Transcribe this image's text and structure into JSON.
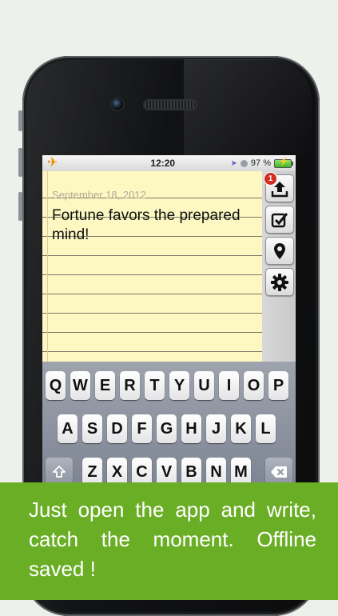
{
  "status_bar": {
    "time": "12:20",
    "battery": "97 %",
    "icons": [
      "airplane-icon",
      "location-arrow-icon",
      "lock-rotation-icon",
      "battery-icon"
    ],
    "colors": {
      "airplane": "#f08a00",
      "location": "#7a55c9",
      "battery_fill": "#3eb51f"
    }
  },
  "note": {
    "date": "September 18, 2012",
    "text": "Fortune favors the prepared mind!"
  },
  "toolbar": {
    "items": [
      {
        "name": "upload-button",
        "icon": "upload-tray-icon",
        "badge": "1"
      },
      {
        "name": "checklist-button",
        "icon": "checkbox-icon"
      },
      {
        "name": "location-button",
        "icon": "map-pin-icon"
      },
      {
        "name": "settings-button",
        "icon": "gear-icon"
      }
    ]
  },
  "keyboard": {
    "row1": [
      "Q",
      "W",
      "E",
      "R",
      "T",
      "Y",
      "U",
      "I",
      "O",
      "P"
    ],
    "row2": [
      "A",
      "S",
      "D",
      "F",
      "G",
      "H",
      "J",
      "K",
      "L"
    ],
    "row3": [
      "Z",
      "X",
      "C",
      "V",
      "B",
      "N",
      "M"
    ],
    "special": {
      "shift": "shift-icon",
      "delete": "delete-key-icon"
    }
  },
  "caption": {
    "text": "Just open the app and write, catch the moment. Offline saved !",
    "background": "#6aae25"
  }
}
